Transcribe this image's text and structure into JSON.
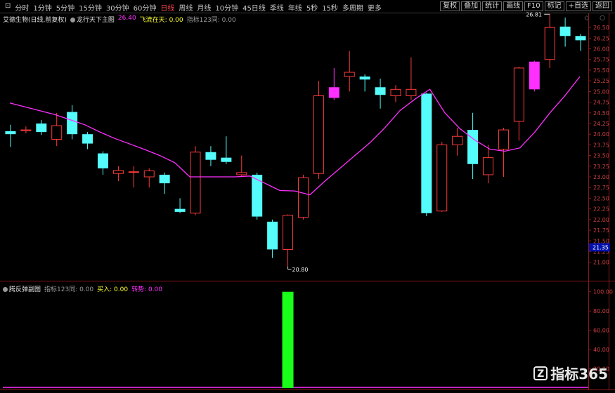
{
  "toolbar": {
    "left_items": [
      "⊡",
      "分时",
      "1分钟",
      "5分钟",
      "15分钟",
      "30分钟",
      "60分钟",
      "日线",
      "周线",
      "月线",
      "10分钟",
      "45日线",
      "季线",
      "年线",
      "5秒",
      "15秒",
      "多周期",
      "更多"
    ],
    "active_index": 7,
    "right_items": [
      "复权",
      "叠加",
      "统计",
      "画线",
      "F10",
      "标记",
      "+自选",
      "返回"
    ]
  },
  "main_panel": {
    "stock_name": "艾德生物(日线,前复权)",
    "indicator_name": "龙行天下主图",
    "value1_label": "26.40",
    "value2_label": "飞流在天: 0.00",
    "value3_label": "指标123同: 0.00",
    "window_controls": "◇ ○"
  },
  "sub_panel": {
    "name": "腾反弹副图",
    "text1": "指标123同: 0.00",
    "text2": "买入: 0.00",
    "text3": "转势: 0.00"
  },
  "watermark": "指标365",
  "colors": {
    "up": "#ff3c3c",
    "down": "#54fcfc",
    "ma": "#ff30ff",
    "special": "#ff30ff",
    "signal": "#1aff1a",
    "price_tag": "#0010aa"
  },
  "chart_data": [
    {
      "type": "candlestick",
      "ylim": [
        20.6,
        26.65
      ],
      "y_ticks": [
        "26.50",
        "26.25",
        "26.00",
        "25.75",
        "25.50",
        "25.25",
        "25.00",
        "24.75",
        "24.50",
        "24.25",
        "24.00",
        "23.75",
        "23.50",
        "23.25",
        "23.00",
        "22.75",
        "22.50",
        "22.25",
        "22.00",
        "21.75",
        "21.50",
        "21.25",
        "21.00"
      ],
      "tick_values": [
        26.5,
        26.25,
        26.0,
        25.75,
        25.5,
        25.25,
        25.0,
        24.75,
        24.5,
        24.25,
        24.0,
        23.75,
        23.5,
        23.25,
        23.0,
        22.75,
        22.5,
        22.25,
        22.0,
        21.75,
        21.5,
        21.25,
        21.0
      ],
      "current_price": "21.35",
      "current_price_value": 21.35,
      "high_annotation": "26.81",
      "low_annotation": "20.80",
      "candles": [
        {
          "o": 24.07,
          "h": 24.22,
          "l": 23.7,
          "c": 24.0,
          "color": "down"
        },
        {
          "o": 24.1,
          "h": 24.18,
          "l": 24.02,
          "c": 24.08,
          "color": "up"
        },
        {
          "o": 24.05,
          "h": 24.33,
          "l": 23.98,
          "c": 24.25,
          "color": "down"
        },
        {
          "o": 23.88,
          "h": 24.5,
          "l": 23.72,
          "c": 24.2,
          "color": "up"
        },
        {
          "o": 24.52,
          "h": 24.68,
          "l": 23.88,
          "c": 24.0,
          "color": "down"
        },
        {
          "o": 24.0,
          "h": 24.05,
          "l": 23.65,
          "c": 23.78,
          "color": "down"
        },
        {
          "o": 23.55,
          "h": 23.6,
          "l": 23.05,
          "c": 23.2,
          "color": "down"
        },
        {
          "o": 23.08,
          "h": 23.25,
          "l": 22.9,
          "c": 23.15,
          "color": "up"
        },
        {
          "o": 23.12,
          "h": 23.25,
          "l": 22.75,
          "c": 23.12,
          "color": "up"
        },
        {
          "o": 23.0,
          "h": 23.2,
          "l": 22.75,
          "c": 23.14,
          "color": "up"
        },
        {
          "o": 23.05,
          "h": 23.1,
          "l": 22.6,
          "c": 22.85,
          "color": "down"
        },
        {
          "o": 22.25,
          "h": 22.5,
          "l": 22.15,
          "c": 22.18,
          "color": "down"
        },
        {
          "o": 22.15,
          "h": 23.72,
          "l": 22.1,
          "c": 23.58,
          "color": "up"
        },
        {
          "o": 23.58,
          "h": 23.72,
          "l": 23.25,
          "c": 23.4,
          "color": "down"
        },
        {
          "o": 23.45,
          "h": 23.95,
          "l": 23.3,
          "c": 23.35,
          "color": "down"
        },
        {
          "o": 23.05,
          "h": 23.5,
          "l": 23.0,
          "c": 23.1,
          "color": "up"
        },
        {
          "o": 23.05,
          "h": 23.1,
          "l": 22.0,
          "c": 22.07,
          "color": "down"
        },
        {
          "o": 21.95,
          "h": 22.0,
          "l": 21.1,
          "c": 21.3,
          "color": "down"
        },
        {
          "o": 21.3,
          "h": 22.12,
          "l": 20.9,
          "c": 22.1,
          "color": "up"
        },
        {
          "o": 22.05,
          "h": 23.05,
          "l": 22.0,
          "c": 22.98,
          "color": "up"
        },
        {
          "o": 23.08,
          "h": 25.25,
          "l": 22.95,
          "c": 24.9,
          "color": "up"
        },
        {
          "o": 24.85,
          "h": 25.55,
          "l": 24.8,
          "c": 25.1,
          "color": "special"
        },
        {
          "o": 25.45,
          "h": 25.95,
          "l": 25.0,
          "c": 25.35,
          "color": "up"
        },
        {
          "o": 25.35,
          "h": 25.4,
          "l": 25.0,
          "c": 25.28,
          "color": "down"
        },
        {
          "o": 25.1,
          "h": 25.3,
          "l": 24.6,
          "c": 24.92,
          "color": "down"
        },
        {
          "o": 24.9,
          "h": 25.15,
          "l": 24.75,
          "c": 25.05,
          "color": "up"
        },
        {
          "o": 24.9,
          "h": 25.8,
          "l": 24.8,
          "c": 25.05,
          "color": "up"
        },
        {
          "o": 24.95,
          "h": 24.97,
          "l": 22.08,
          "c": 22.15,
          "color": "down"
        },
        {
          "o": 22.2,
          "h": 23.82,
          "l": 22.18,
          "c": 23.75,
          "color": "up"
        },
        {
          "o": 23.75,
          "h": 24.15,
          "l": 23.5,
          "c": 23.95,
          "color": "up"
        },
        {
          "o": 24.1,
          "h": 24.5,
          "l": 22.95,
          "c": 23.3,
          "color": "down"
        },
        {
          "o": 23.05,
          "h": 23.75,
          "l": 22.85,
          "c": 23.45,
          "color": "up"
        },
        {
          "o": 23.65,
          "h": 24.15,
          "l": 23.0,
          "c": 24.1,
          "color": "up"
        },
        {
          "o": 24.3,
          "h": 25.58,
          "l": 23.85,
          "c": 25.55,
          "color": "up"
        },
        {
          "o": 25.05,
          "h": 25.72,
          "l": 25.0,
          "c": 25.7,
          "color": "special"
        },
        {
          "o": 25.75,
          "h": 26.81,
          "l": 25.55,
          "c": 26.5,
          "color": "up"
        },
        {
          "o": 26.52,
          "h": 26.73,
          "l": 26.05,
          "c": 26.3,
          "color": "down"
        },
        {
          "o": 26.3,
          "h": 26.35,
          "l": 25.95,
          "c": 26.2,
          "color": "down"
        }
      ],
      "ma_series": [
        24.73,
        24.64,
        24.55,
        24.46,
        24.34,
        24.22,
        24.05,
        23.9,
        23.77,
        23.64,
        23.5,
        23.33,
        23.0,
        23.0,
        23.0,
        23.0,
        23.02,
        22.85,
        22.68,
        22.67,
        22.58,
        22.9,
        23.2,
        23.5,
        23.8,
        24.15,
        24.55,
        24.82,
        25.05,
        24.5,
        24.13,
        23.86,
        23.65,
        23.6,
        23.68,
        24.05,
        24.5,
        24.9,
        25.35
      ]
    },
    {
      "type": "bar",
      "ylim": [
        0,
        110
      ],
      "y_ticks": [
        "100.00",
        "80.00",
        "60.00",
        "40.00",
        "20.00"
      ],
      "tick_values": [
        100,
        80,
        60,
        40,
        20
      ],
      "signals": [
        {
          "index": 18,
          "value": 100
        }
      ]
    }
  ]
}
